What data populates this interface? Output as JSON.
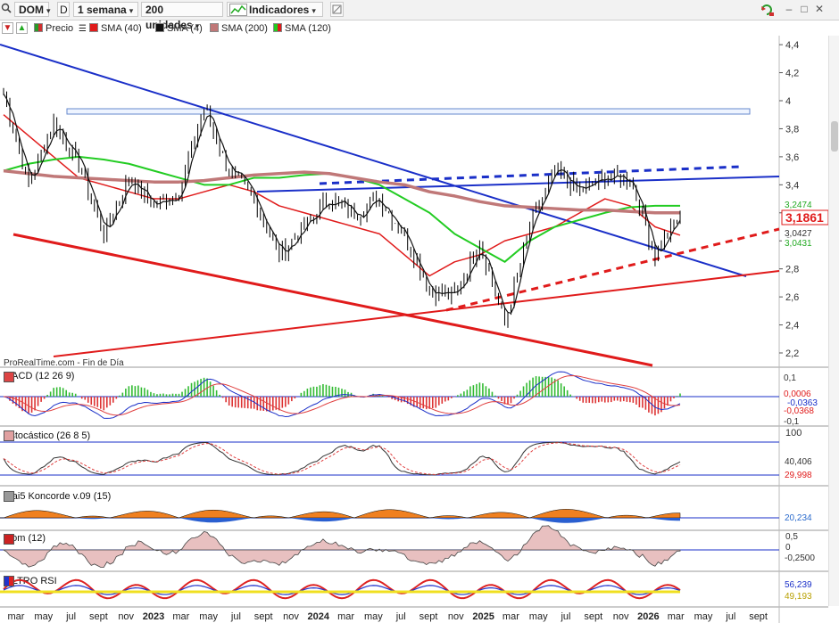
{
  "toolbar": {
    "symbol": "DOM",
    "period_icon": "D",
    "interval": "1 semana",
    "units": "200 unidades",
    "indicators": "Indicadores",
    "chevron": "▾",
    "win_min": "–",
    "win_max": "□",
    "win_close": "✕"
  },
  "legend": {
    "price": "Precio",
    "sma40": "SMA (40)",
    "sma4": "SMA (4)",
    "sma200": "SMA (200)",
    "sma120": "SMA (120)"
  },
  "colors": {
    "price": "#000000",
    "sma4": "#111111",
    "sma40": "#e01b1b",
    "sma120": "#22cc22",
    "sma200": "#c07878",
    "trend_blue": "#1a2fc8",
    "trend_red": "#e01b1b",
    "macd": "#1a2fc8",
    "signal": "#e04040",
    "hist_pos": "#33bb33",
    "hist_neg": "#dd3333"
  },
  "watermark": "ProRealTime.com - Fin de Día",
  "badges": {
    "last_price": "3,1861",
    "sma120_val": "3,2474",
    "sma40_val": "3,0427",
    "sma4_val": "3,0431"
  },
  "panels": {
    "macd": {
      "title": "MACD (12 26 9)",
      "v1": "0,1",
      "v2": "0,0006",
      "v3": "-0,0363",
      "v4": "-0,0368",
      "v5": "-0,1"
    },
    "stoch": {
      "title": "Estocástico (26 8 5)",
      "v1": "100",
      "v2": "40,406",
      "v3": "29,998"
    },
    "konc": {
      "title": "Blai5 Koncorde v.09 (15)",
      "v1": "20,234"
    },
    "mom": {
      "title": "Mom (12)",
      "v1": "0,5",
      "v2": "0",
      "v3": "-0,2500"
    },
    "rsi": {
      "title": "FILTRO RSI",
      "v1": "56,239",
      "v2": "49,193"
    }
  },
  "chart_data": {
    "type": "line",
    "title": "",
    "xlabel": "",
    "ylabel": "",
    "ylim": [
      2.1,
      4.5
    ],
    "y_ticks": [
      "4,4",
      "4,2",
      "4",
      "3,8",
      "3,6",
      "3,4",
      "3,2",
      "3",
      "2,8",
      "2,6",
      "2,4",
      "2,2"
    ],
    "x_ticks": [
      "mar",
      "may",
      "jul",
      "sept",
      "nov",
      "2023",
      "mar",
      "may",
      "jul",
      "sept",
      "nov",
      "2024",
      "mar",
      "may",
      "jul",
      "sept",
      "nov",
      "2025",
      "mar",
      "may",
      "jul",
      "sept",
      "nov",
      "2026",
      "mar",
      "may",
      "jul",
      "sept"
    ],
    "series": [
      {
        "name": "Precio",
        "dates": [
          "2022-03",
          "2022-05",
          "2022-07",
          "2022-09",
          "2022-11",
          "2023-01",
          "2023-03",
          "2023-05",
          "2023-06",
          "2023-07",
          "2023-09",
          "2023-11",
          "2024-01",
          "2024-03",
          "2024-05",
          "2024-07",
          "2024-09",
          "2024-11",
          "2025-01",
          "2025-03",
          "2025-05",
          "2025-07",
          "2025-09",
          "2025-11",
          "2026-01",
          "2026-02",
          "2026-03",
          "2026-04"
        ],
        "values": [
          4.05,
          3.4,
          3.85,
          3.55,
          3.05,
          3.45,
          3.25,
          3.35,
          3.95,
          3.5,
          3.3,
          2.9,
          3.1,
          3.3,
          3.2,
          3.3,
          3.05,
          2.65,
          2.6,
          3.0,
          2.4,
          3.1,
          3.5,
          3.35,
          3.45,
          3.45,
          2.9,
          3.19
        ]
      },
      {
        "name": "SMA (40)",
        "values": [
          3.9,
          3.75,
          3.6,
          3.45,
          3.4,
          3.35,
          3.3,
          3.3,
          3.35,
          3.4,
          3.35,
          3.25,
          3.2,
          3.15,
          3.1,
          3.05,
          2.9,
          2.75,
          2.85,
          2.9,
          3.0,
          3.05,
          3.1,
          3.2,
          3.3,
          3.25,
          3.1,
          3.04
        ]
      },
      {
        "name": "SMA (120)",
        "values": [
          3.5,
          3.55,
          3.58,
          3.6,
          3.58,
          3.55,
          3.5,
          3.45,
          3.4,
          3.4,
          3.45,
          3.45,
          3.47,
          3.48,
          3.45,
          3.4,
          3.3,
          3.2,
          3.05,
          2.95,
          2.85,
          3.0,
          3.1,
          3.15,
          3.2,
          3.24,
          3.25,
          3.25
        ]
      },
      {
        "name": "SMA (200)",
        "values": [
          3.5,
          3.48,
          3.46,
          3.45,
          3.44,
          3.43,
          3.42,
          3.42,
          3.43,
          3.45,
          3.47,
          3.48,
          3.49,
          3.48,
          3.45,
          3.42,
          3.4,
          3.35,
          3.32,
          3.28,
          3.25,
          3.24,
          3.23,
          3.22,
          3.22,
          3.21,
          3.2,
          3.2
        ]
      }
    ]
  }
}
